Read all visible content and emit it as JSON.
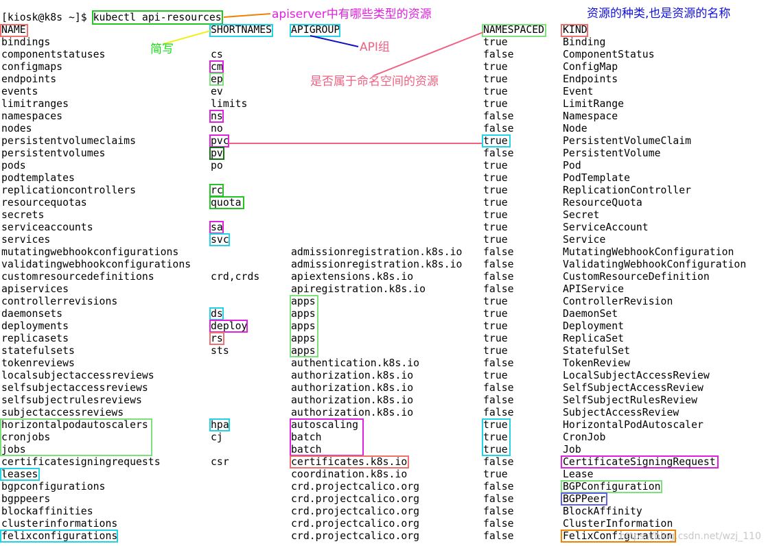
{
  "terminal": {
    "prompt": "[kiosk@k8s ~]$ ",
    "command": "kubectl api-resources",
    "headers": [
      "NAME",
      "SHORTNAMES",
      "APIGROUP",
      "NAMESPACED",
      "KIND"
    ],
    "rows": [
      {
        "name": "bindings",
        "short": "",
        "group": "",
        "ns": "true",
        "kind": "Binding"
      },
      {
        "name": "componentstatuses",
        "short": "cs",
        "group": "",
        "ns": "false",
        "kind": "ComponentStatus"
      },
      {
        "name": "configmaps",
        "short": "cm",
        "group": "",
        "ns": "true",
        "kind": "ConfigMap"
      },
      {
        "name": "endpoints",
        "short": "ep",
        "group": "",
        "ns": "true",
        "kind": "Endpoints"
      },
      {
        "name": "events",
        "short": "ev",
        "group": "",
        "ns": "true",
        "kind": "Event"
      },
      {
        "name": "limitranges",
        "short": "limits",
        "group": "",
        "ns": "true",
        "kind": "LimitRange"
      },
      {
        "name": "namespaces",
        "short": "ns",
        "group": "",
        "ns": "false",
        "kind": "Namespace"
      },
      {
        "name": "nodes",
        "short": "no",
        "group": "",
        "ns": "false",
        "kind": "Node"
      },
      {
        "name": "persistentvolumeclaims",
        "short": "pvc",
        "group": "",
        "ns": "true",
        "kind": "PersistentVolumeClaim"
      },
      {
        "name": "persistentvolumes",
        "short": "pv",
        "group": "",
        "ns": "false",
        "kind": "PersistentVolume"
      },
      {
        "name": "pods",
        "short": "po",
        "group": "",
        "ns": "true",
        "kind": "Pod"
      },
      {
        "name": "podtemplates",
        "short": "",
        "group": "",
        "ns": "true",
        "kind": "PodTemplate"
      },
      {
        "name": "replicationcontrollers",
        "short": "rc",
        "group": "",
        "ns": "true",
        "kind": "ReplicationController"
      },
      {
        "name": "resourcequotas",
        "short": "quota",
        "group": "",
        "ns": "true",
        "kind": "ResourceQuota"
      },
      {
        "name": "secrets",
        "short": "",
        "group": "",
        "ns": "true",
        "kind": "Secret"
      },
      {
        "name": "serviceaccounts",
        "short": "sa",
        "group": "",
        "ns": "true",
        "kind": "ServiceAccount"
      },
      {
        "name": "services",
        "short": "svc",
        "group": "",
        "ns": "true",
        "kind": "Service"
      },
      {
        "name": "mutatingwebhookconfigurations",
        "short": "",
        "group": "admissionregistration.k8s.io",
        "ns": "false",
        "kind": "MutatingWebhookConfiguration"
      },
      {
        "name": "validatingwebhookconfigurations",
        "short": "",
        "group": "admissionregistration.k8s.io",
        "ns": "false",
        "kind": "ValidatingWebhookConfiguration"
      },
      {
        "name": "customresourcedefinitions",
        "short": "crd,crds",
        "group": "apiextensions.k8s.io",
        "ns": "false",
        "kind": "CustomResourceDefinition"
      },
      {
        "name": "apiservices",
        "short": "",
        "group": "apiregistration.k8s.io",
        "ns": "false",
        "kind": "APIService"
      },
      {
        "name": "controllerrevisions",
        "short": "",
        "group": "apps",
        "ns": "true",
        "kind": "ControllerRevision"
      },
      {
        "name": "daemonsets",
        "short": "ds",
        "group": "apps",
        "ns": "true",
        "kind": "DaemonSet"
      },
      {
        "name": "deployments",
        "short": "deploy",
        "group": "apps",
        "ns": "true",
        "kind": "Deployment"
      },
      {
        "name": "replicasets",
        "short": "rs",
        "group": "apps",
        "ns": "true",
        "kind": "ReplicaSet"
      },
      {
        "name": "statefulsets",
        "short": "sts",
        "group": "apps",
        "ns": "true",
        "kind": "StatefulSet"
      },
      {
        "name": "tokenreviews",
        "short": "",
        "group": "authentication.k8s.io",
        "ns": "false",
        "kind": "TokenReview"
      },
      {
        "name": "localsubjectaccessreviews",
        "short": "",
        "group": "authorization.k8s.io",
        "ns": "true",
        "kind": "LocalSubjectAccessReview"
      },
      {
        "name": "selfsubjectaccessreviews",
        "short": "",
        "group": "authorization.k8s.io",
        "ns": "false",
        "kind": "SelfSubjectAccessReview"
      },
      {
        "name": "selfsubjectrulesreviews",
        "short": "",
        "group": "authorization.k8s.io",
        "ns": "false",
        "kind": "SelfSubjectRulesReview"
      },
      {
        "name": "subjectaccessreviews",
        "short": "",
        "group": "authorization.k8s.io",
        "ns": "false",
        "kind": "SubjectAccessReview"
      },
      {
        "name": "horizontalpodautoscalers",
        "short": "hpa",
        "group": "autoscaling",
        "ns": "true",
        "kind": "HorizontalPodAutoscaler"
      },
      {
        "name": "cronjobs",
        "short": "cj",
        "group": "batch",
        "ns": "true",
        "kind": "CronJob"
      },
      {
        "name": "jobs",
        "short": "",
        "group": "batch",
        "ns": "true",
        "kind": "Job"
      },
      {
        "name": "certificatesigningrequests",
        "short": "csr",
        "group": "certificates.k8s.io",
        "ns": "false",
        "kind": "CertificateSigningRequest"
      },
      {
        "name": "leases",
        "short": "",
        "group": "coordination.k8s.io",
        "ns": "true",
        "kind": "Lease"
      },
      {
        "name": "bgpconfigurations",
        "short": "",
        "group": "crd.projectcalico.org",
        "ns": "false",
        "kind": "BGPConfiguration"
      },
      {
        "name": "bgppeers",
        "short": "",
        "group": "crd.projectcalico.org",
        "ns": "false",
        "kind": "BGPPeer"
      },
      {
        "name": "blockaffinities",
        "short": "",
        "group": "crd.projectcalico.org",
        "ns": "false",
        "kind": "BlockAffinity"
      },
      {
        "name": "clusterinformations",
        "short": "",
        "group": "crd.projectcalico.org",
        "ns": "false",
        "kind": "ClusterInformation"
      },
      {
        "name": "felixconfigurations",
        "short": "",
        "group": "crd.projectcalico.org",
        "ns": "false",
        "kind": "FelixConfiguration"
      }
    ]
  },
  "annotations": {
    "apiserver_note": "apiserver中有哪些类型的资源",
    "kind_note": "资源的种类,也是资源的名称",
    "shortname_note": "简写",
    "apigroup_note": "API组",
    "namespaced_note": "是否属于命名空间的资源"
  },
  "watermark": "https://blog.csdn.net/wzj_110",
  "colors": {
    "background": "#ffffff",
    "text": "#000000",
    "box_green": "#22c522",
    "box_cyan": "#22d3e6",
    "box_magenta": "#e020e0",
    "box_salmon": "#f07070",
    "box_lightgreen": "#7ce07c",
    "box_darkgreen": "#107010",
    "box_orange": "#f08000",
    "box_blue": "#6060e8",
    "note_magenta": "#e020e0",
    "note_blue": "#1010e0",
    "note_green": "#10e010",
    "note_pink": "#f06080"
  }
}
